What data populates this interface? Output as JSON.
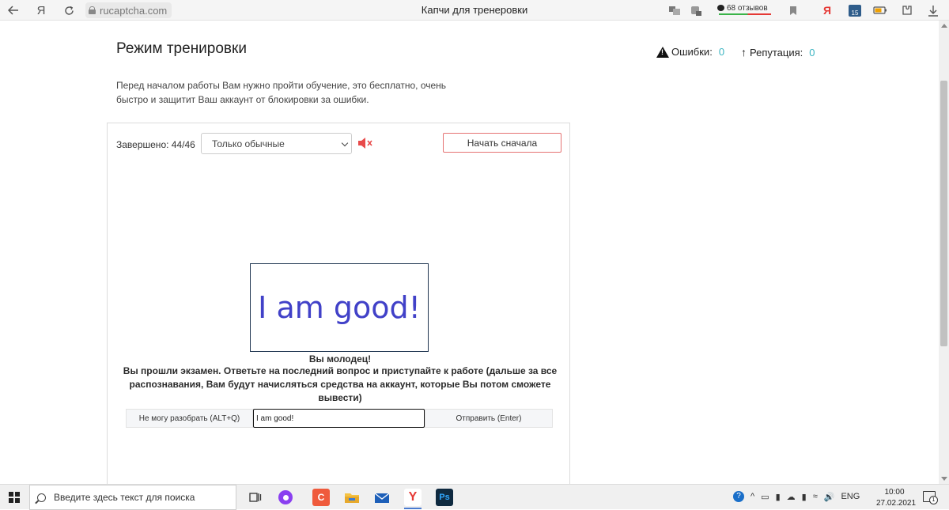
{
  "browser": {
    "back_icon": "arrow-left-icon",
    "yandex_letter": "Я",
    "url": "rucaptcha.com",
    "title": "Капчи для тренеровки",
    "reviews": "68 отзывов",
    "calendar_day": "15",
    "tray_yandex": "Я"
  },
  "header": {
    "title": "Режим тренировки",
    "errors_label": "Ошибки:",
    "errors_value": "0",
    "reputation_label": "Репутация:",
    "reputation_value": "0"
  },
  "intro": {
    "text": "Перед началом работы Вам нужно пройти обучение, это бесплатно, очень быстро и защитит Ваш аккаунт от блокировки за ошибки."
  },
  "training": {
    "completed_label": "Завершено: 44/46",
    "filter_selected": "Только обычные",
    "restart_label": "Начать сначала",
    "captcha_text": "I am good!",
    "message_title": "Вы молодец!",
    "message_body": "Вы прошли экзамен. Ответьте на последний вопрос и приступайте к работе (дальше за все распознавания, Вам будут начисляться средства на аккаунт, которые Вы потом сможете вывести)",
    "cant_read_label": "Не могу разобрать (ALT+Q)",
    "answer_value": "I am good!",
    "submit_label": "Отправить (Enter)"
  },
  "taskbar": {
    "search_placeholder": "Введите здесь текст для поиска",
    "language": "ENG",
    "time": "10:00",
    "date": "27.02.2021",
    "notifications_count": "1"
  },
  "colors": {
    "accent_teal": "#3bb4c1",
    "captcha_text": "#4141c8",
    "restart_border": "#e57373",
    "mute_red": "#e84a4a"
  }
}
